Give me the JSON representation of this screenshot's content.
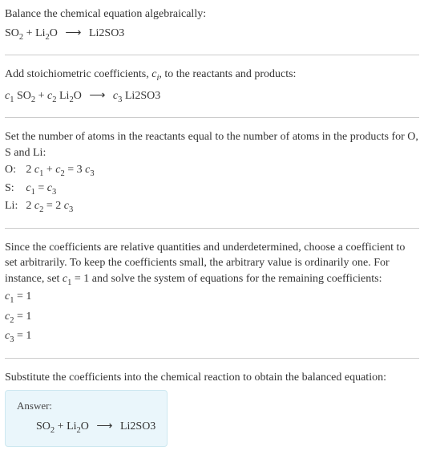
{
  "step1": {
    "instruction": "Balance the chemical equation algebraically:",
    "reactant1": "SO",
    "reactant1_sub": "2",
    "plus": " + ",
    "reactant2": "Li",
    "reactant2_sub": "2",
    "reactant2_suffix": "O",
    "arrow": "⟶",
    "product": "Li2SO3"
  },
  "step2": {
    "instruction_a": "Add stoichiometric coefficients, ",
    "coef_var": "c",
    "coef_sub": "i",
    "instruction_b": ", to the reactants and products:",
    "c1": "c",
    "c1_sub": "1",
    "r1": " SO",
    "r1_sub": "2",
    "plus": " + ",
    "c2": "c",
    "c2_sub": "2",
    "r2": " Li",
    "r2_sub": "2",
    "r2_suffix": "O",
    "arrow": "⟶",
    "c3": "c",
    "c3_sub": "3",
    "p1": " Li2SO3"
  },
  "step3": {
    "instruction": "Set the number of atoms in the reactants equal to the number of atoms in the products for O, S and Li:",
    "rows": [
      {
        "label": "O:",
        "lhs_a": "2 ",
        "c1": "c",
        "c1s": "1",
        "mid": " + ",
        "c2": "c",
        "c2s": "2",
        "eq": " = 3 ",
        "c3": "c",
        "c3s": "3"
      },
      {
        "label": "S:",
        "c1": "c",
        "c1s": "1",
        "eq": " = ",
        "c3": "c",
        "c3s": "3"
      },
      {
        "label": "Li:",
        "lhs_a": "2 ",
        "c2": "c",
        "c2s": "2",
        "eq": " = 2 ",
        "c3": "c",
        "c3s": "3"
      }
    ]
  },
  "step4": {
    "instruction_a": "Since the coefficients are relative quantities and underdetermined, choose a coefficient to set arbitrarily. To keep the coefficients small, the arbitrary value is ordinarily one. For instance, set ",
    "cvar": "c",
    "csub": "1",
    "instruction_b": " = 1 and solve the system of equations for the remaining coefficients:",
    "results": [
      {
        "c": "c",
        "s": "1",
        "val": " = 1"
      },
      {
        "c": "c",
        "s": "2",
        "val": " = 1"
      },
      {
        "c": "c",
        "s": "3",
        "val": " = 1"
      }
    ]
  },
  "step5": {
    "instruction": "Substitute the coefficients into the chemical reaction to obtain the balanced equation:",
    "answer_label": "Answer:",
    "reactant1": "SO",
    "reactant1_sub": "2",
    "plus": " + ",
    "reactant2": "Li",
    "reactant2_sub": "2",
    "reactant2_suffix": "O",
    "arrow": "⟶",
    "product": "Li2SO3"
  }
}
